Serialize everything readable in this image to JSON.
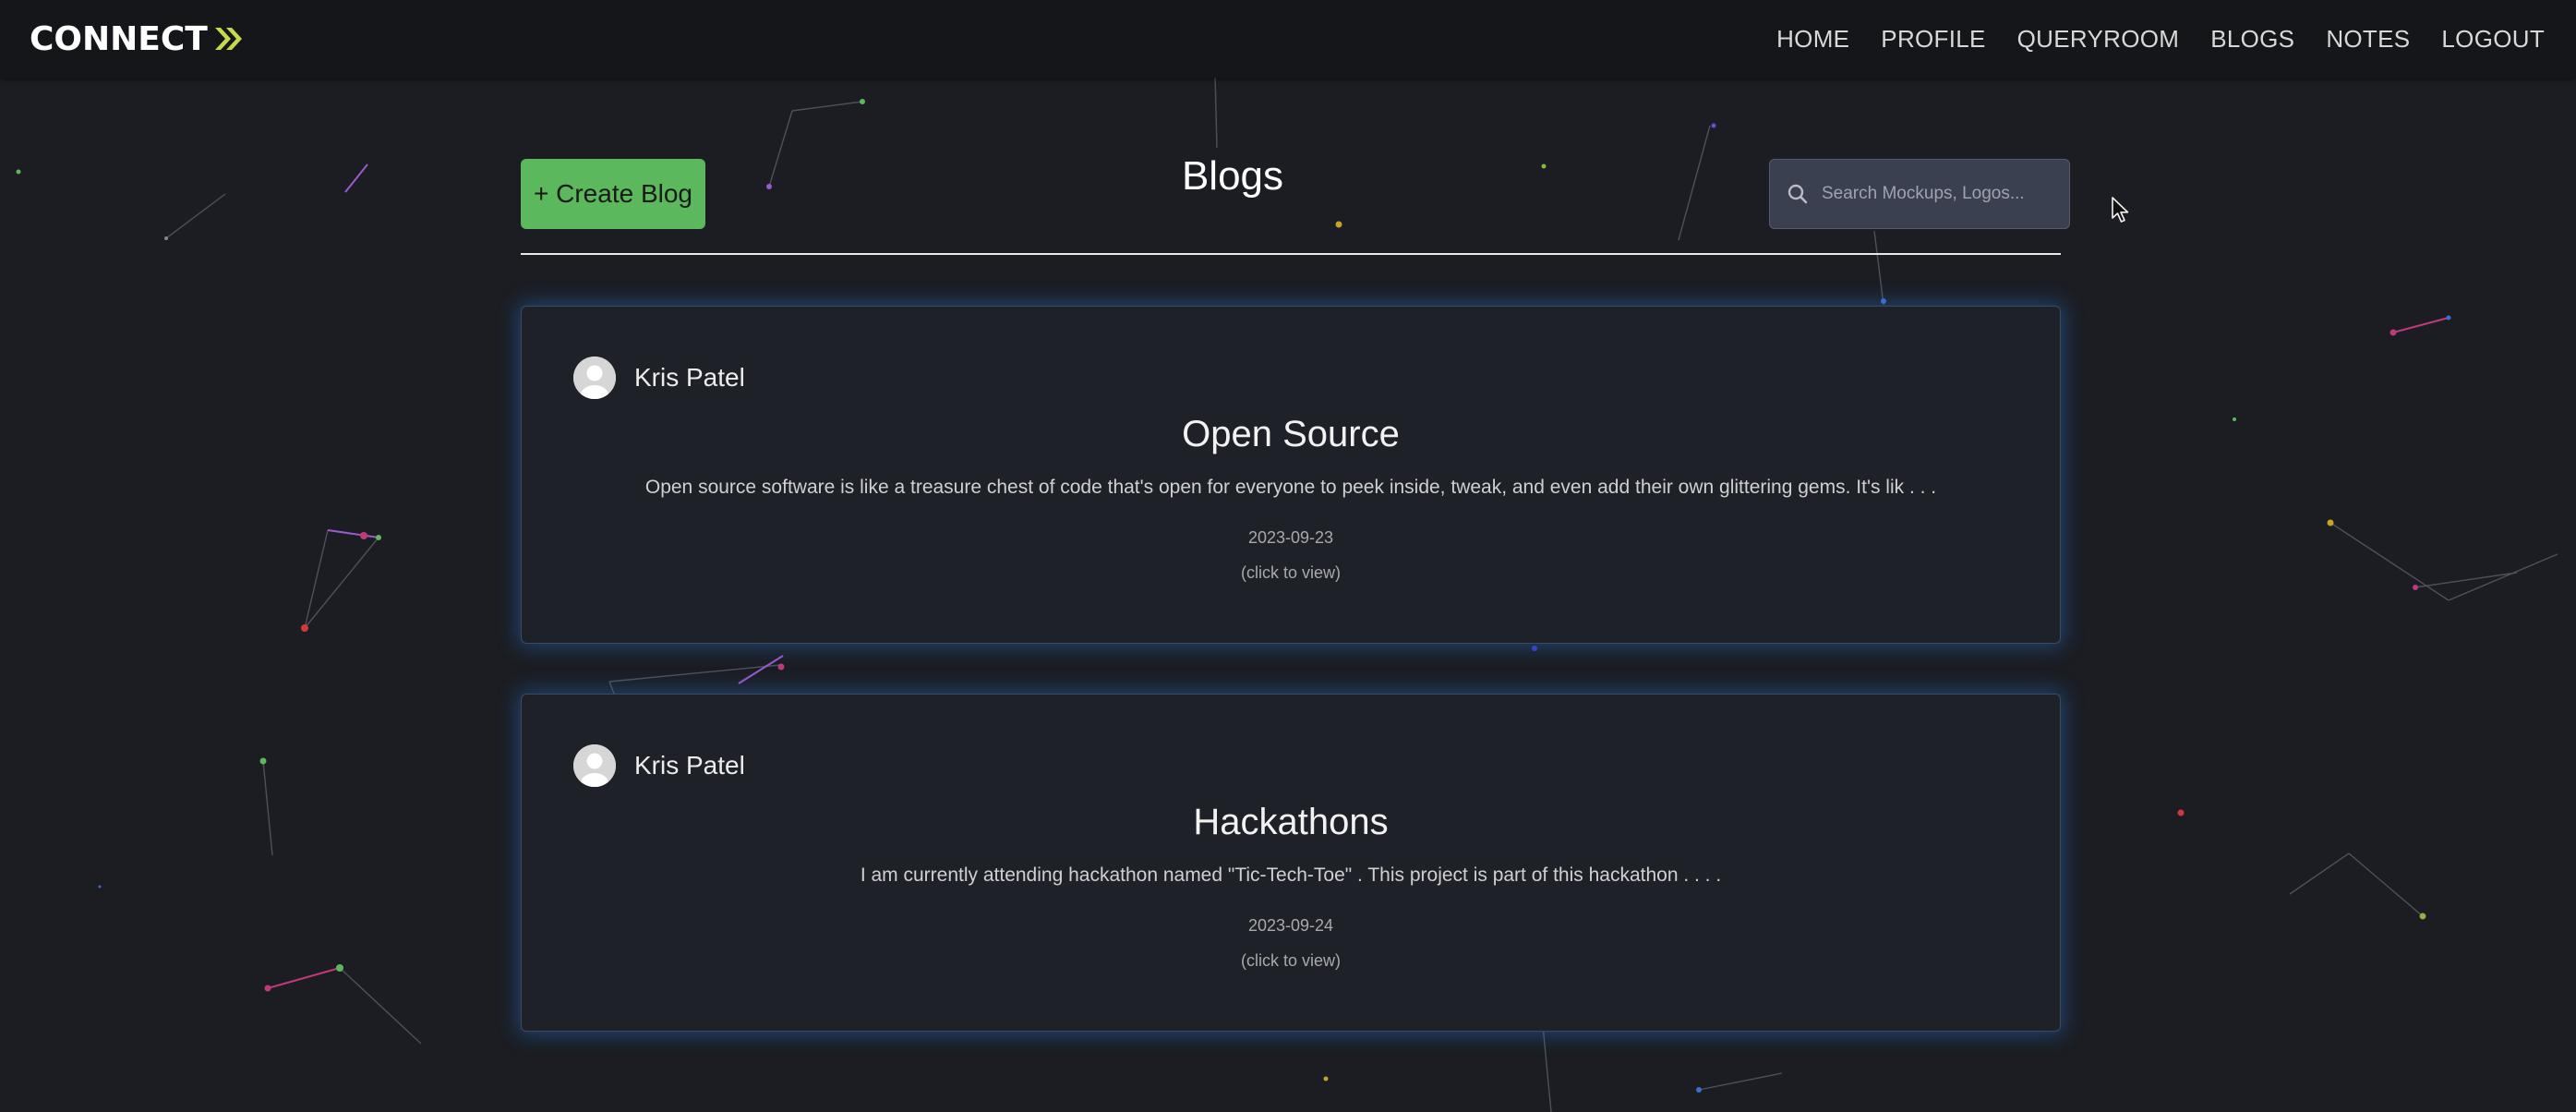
{
  "app": {
    "logo_text": "CONNECT"
  },
  "nav": {
    "items": [
      {
        "label": "HOME"
      },
      {
        "label": "PROFILE"
      },
      {
        "label": "QUERYROOM"
      },
      {
        "label": "BLOGS"
      },
      {
        "label": "NOTES"
      },
      {
        "label": "LOGOUT"
      }
    ]
  },
  "header": {
    "create_label": "+ Create Blog",
    "title": "Blogs"
  },
  "search": {
    "placeholder": "Search Mockups, Logos...",
    "value": ""
  },
  "blogs": [
    {
      "author": "Kris Patel",
      "title": "Open Source",
      "excerpt": "Open source software is like a treasure chest of code that's open for everyone to peek inside, tweak, and even add their own glittering gems. It's lik . . .",
      "date": "2023-09-23",
      "hint": "(click to view)"
    },
    {
      "author": "Kris Patel",
      "title": "Hackathons",
      "excerpt": "I am currently attending hackathon named \"Tic-Tech-Toe\" . This project is part of this hackathon . . . .",
      "date": "2023-09-24",
      "hint": "(click to view)"
    }
  ],
  "colors": {
    "background": "#1b1d22",
    "navbar": "#14161a",
    "create_button": "#5cb85c",
    "logo_accent": "#c6d94a",
    "card_glow": "#286ec8"
  }
}
